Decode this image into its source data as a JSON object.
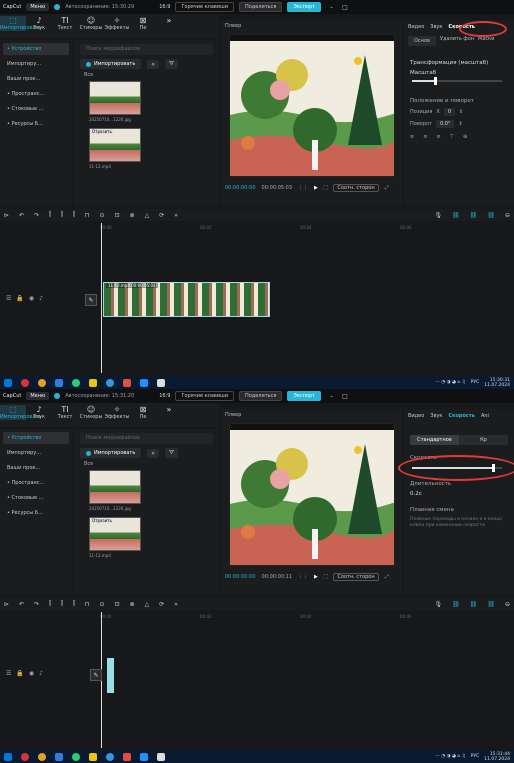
{
  "titlebar": {
    "logo": "CapCut",
    "menu": "Меню",
    "autosave_1": "Автосохранение: 15:30:29",
    "autosave_2": "Автосохранение: 15:31:20",
    "aspect": "16:9",
    "hotkeys": "Горячие клавиши",
    "share": "Поделиться",
    "export": "Экспорт"
  },
  "tools": [
    {
      "label": "Импортировать",
      "icon": "import-icon",
      "glyph": "⬚"
    },
    {
      "label": "Звук",
      "icon": "sound-icon",
      "glyph": "♪"
    },
    {
      "label": "Текст",
      "icon": "text-icon",
      "glyph": "TI"
    },
    {
      "label": "Стикеры",
      "icon": "sticker-icon",
      "glyph": "☺"
    },
    {
      "label": "Эффекты",
      "icon": "effects-icon",
      "glyph": "✧"
    },
    {
      "label": "Пе",
      "icon": "transition-icon",
      "glyph": "⊠"
    }
  ],
  "leftnav": [
    "• Устройство",
    "Импортиру...",
    "Ваши прое...",
    "• Пространс...",
    "• Стоковые ...",
    "• Ресурсы Б..."
  ],
  "media": {
    "search_placeholder": "Поиск медиафайлов",
    "import_label": "Импортировать",
    "section": "Все",
    "item1_cap": "20250710...1226.jpg",
    "item2_cap": "11-12.mp4",
    "item2_badge": "Отразить"
  },
  "player": {
    "label": "Плеер",
    "tc1": "00:00:00:00",
    "dur1": "00:00:05:03",
    "tc2": "00:00:00:00",
    "dur2": "00:00:00:11",
    "fit": "Соотн. сторон"
  },
  "inspector": {
    "tabs1": [
      "Видео",
      "Звук",
      "Скорость"
    ],
    "tabs2": [
      "Видео",
      "Звук",
      "Скорость",
      "Ani"
    ],
    "row1": [
      "Основ",
      "Удалить фон",
      "Маски"
    ],
    "transform": "Трансформация (масштаб)",
    "scale_label": "Масштаб",
    "scale_value": 0.25,
    "position_label": "Положение и поворот",
    "pos_x_label": "Позиция",
    "pos_x": "0",
    "rotate_label": "Поворот",
    "rotate": "0.0°",
    "seg": [
      "Стандартное",
      "Кр"
    ],
    "speed_label": "Скорость",
    "speed_value": 0.9,
    "duration_label": "Длительность",
    "duration_value": "0.2с",
    "smooth_label": "Плавная смена",
    "smooth_desc": "Плавные переходы в начале и в конце клипа при изменении скорости"
  },
  "timeline": {
    "clip1_cap": "11-12.mp4  00:00:05:03",
    "ruler1": [
      "00:00",
      "00:02",
      "00:04",
      "00:06"
    ],
    "ruler2": [
      "00:00",
      "00:02",
      "00:04",
      "00:06"
    ]
  },
  "taskbar": {
    "lang": "РУС",
    "time1": "15:30:31",
    "date1": "11.07.2024",
    "time2": "15:31:44",
    "date2": "11.07.2024"
  },
  "colors": {
    "accent": "#27b7d6",
    "annotation": "#e23a3a",
    "taskbar": "#0a1a30"
  }
}
